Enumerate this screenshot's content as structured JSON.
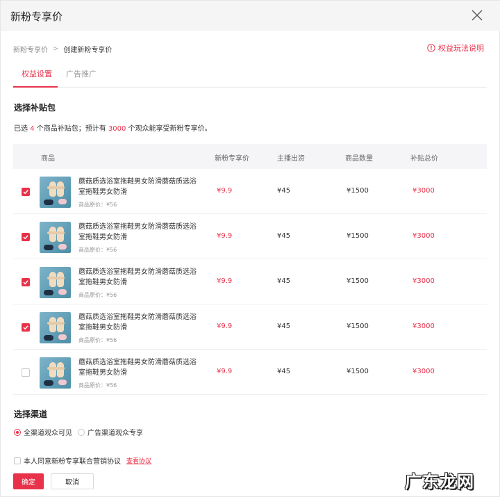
{
  "dialog": {
    "title": "新粉专享价"
  },
  "breadcrumb": {
    "items": [
      "新粉专享价",
      "创建新粉专享价"
    ]
  },
  "rules_link": "权益玩法说明",
  "tabs": [
    {
      "label": "权益设置",
      "active": true
    },
    {
      "label": "广告推广",
      "active": false
    }
  ],
  "subsidy": {
    "title": "选择补贴包",
    "summary_pre": "已选",
    "count": "4",
    "summary_mid": "个商品补贴包；预计有",
    "viewers": "3000",
    "summary_post": "个观众能享受新粉专享价。"
  },
  "table": {
    "headers": [
      "商品",
      "新粉专享价",
      "主播出资",
      "商品数量",
      "补贴总价"
    ],
    "rows": [
      {
        "checked": true,
        "name": "蘑菇质选浴室拖鞋男女防滑蘑菇质选浴室拖鞋男女防滑",
        "original": "商品原价：¥56",
        "price": "¥9.9",
        "host": "¥45",
        "qty": "¥1500",
        "total": "¥3000"
      },
      {
        "checked": true,
        "name": "蘑菇质选浴室拖鞋男女防滑蘑菇质选浴室拖鞋男女防滑",
        "original": "商品原价：¥56",
        "price": "¥9.9",
        "host": "¥45",
        "qty": "¥1500",
        "total": "¥3000"
      },
      {
        "checked": true,
        "name": "蘑菇质选浴室拖鞋男女防滑蘑菇质选浴室拖鞋男女防滑",
        "original": "商品原价：¥56",
        "price": "¥9.9",
        "host": "¥45",
        "qty": "¥1500",
        "total": "¥3000"
      },
      {
        "checked": true,
        "name": "蘑菇质选浴室拖鞋男女防滑蘑菇质选浴室拖鞋男女防滑",
        "original": "商品原价：¥56",
        "price": "¥9.9",
        "host": "¥45",
        "qty": "¥1500",
        "total": "¥3000"
      },
      {
        "checked": false,
        "name": "蘑菇质选浴室拖鞋男女防滑蘑菇质选浴室拖鞋男女防滑",
        "original": "商品原价：¥56",
        "price": "¥9.9",
        "host": "¥45",
        "qty": "¥1500",
        "total": "¥3000"
      }
    ]
  },
  "channel": {
    "title": "选择渠道",
    "options": [
      {
        "label": "全渠道观众可见",
        "selected": true
      },
      {
        "label": "广告渠道观众专享",
        "selected": false
      }
    ]
  },
  "agreement": {
    "label": "本人同意新粉专享联合营销协议",
    "link": "查看协议"
  },
  "buttons": {
    "confirm": "确定",
    "cancel": "取消"
  },
  "watermark": "广东龙网",
  "colors": {
    "accent": "#e8324a"
  }
}
